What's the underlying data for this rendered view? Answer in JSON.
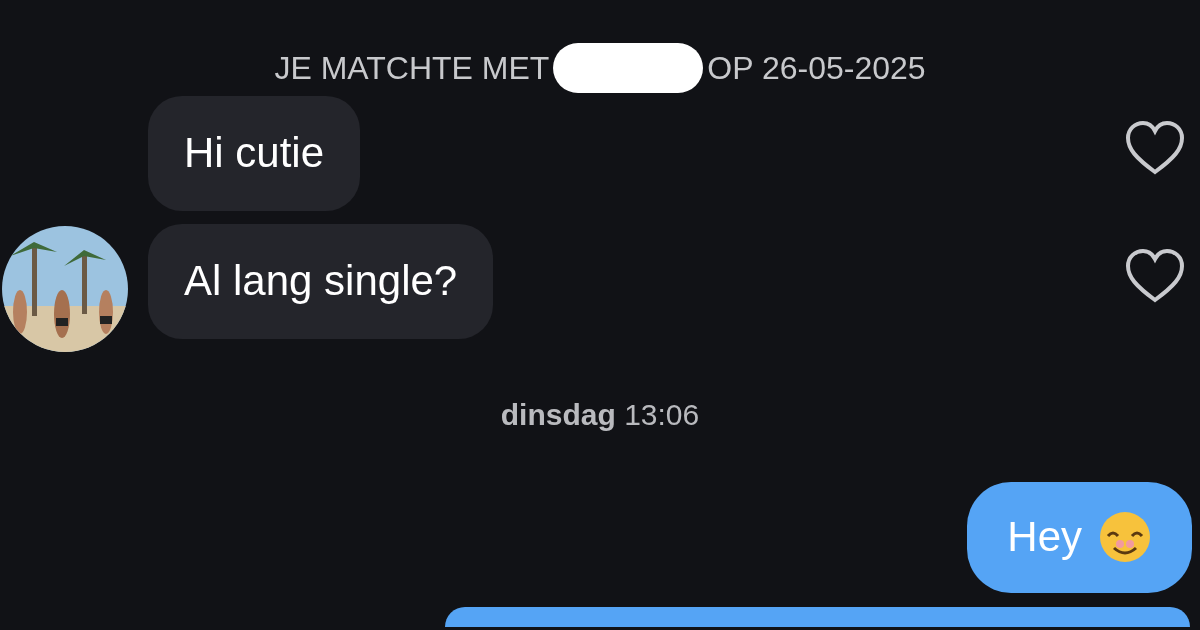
{
  "match_notice": {
    "prefix": "JE MATCHTE MET",
    "redacted": true,
    "suffix": "OP 26-05-2025"
  },
  "messages": [
    {
      "kind": "received",
      "text": "Hi cutie",
      "avatar": false,
      "liked": false
    },
    {
      "kind": "received",
      "text": "Al lang single?",
      "avatar": true,
      "liked": false
    },
    {
      "kind": "timestamp",
      "text": "**dinsdag** 13:06"
    },
    {
      "kind": "sent",
      "text": "Hey",
      "emoji": true
    },
    {
      "kind": "sent"
    }
  ]
}
